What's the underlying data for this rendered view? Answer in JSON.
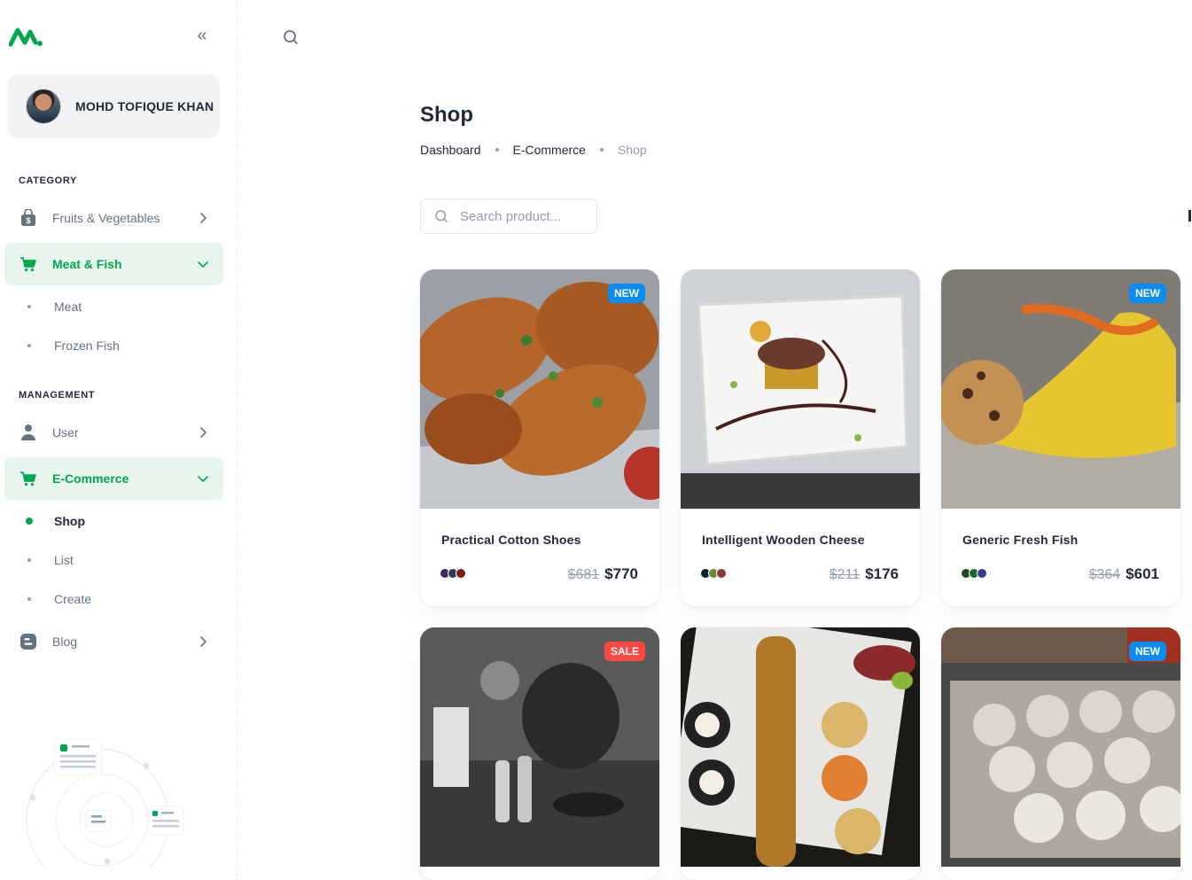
{
  "sidebar": {
    "account_name": "MOHD TOFIQUE KHAN",
    "category_title": "CATEGORY",
    "management_title": "MANAGEMENT",
    "items": [
      {
        "label": "Fruits & Vegetables",
        "icon": "shopping-bag-icon"
      },
      {
        "label": "Meat & Fish",
        "icon": "cart-icon",
        "active": true
      },
      {
        "label": "User",
        "icon": "user-icon"
      },
      {
        "label": "E-Commerce",
        "icon": "cart-icon",
        "active": true
      },
      {
        "label": "Blog",
        "icon": "blog-icon"
      }
    ],
    "meat_sub": [
      "Meat",
      "Frozen Fish"
    ],
    "ecommerce_sub": [
      "Shop",
      "List",
      "Create"
    ],
    "active_sub": "Shop"
  },
  "page": {
    "title": "Shop",
    "breadcrumb": [
      "Dashboard",
      "E-Commerce",
      "Shop"
    ]
  },
  "search": {
    "placeholder": "Search product..."
  },
  "colors": {
    "primary": "#00a651",
    "new_badge": "#0c8cf0",
    "sale_badge": "#ff4842"
  },
  "products": [
    {
      "name": "Practical Cotton Shoes",
      "badge": "NEW",
      "old_price": "$681",
      "price": "$770",
      "colors": [
        "#3a2a5c",
        "#2e3d55",
        "#7a1a1a"
      ]
    },
    {
      "name": "Intelligent Wooden Cheese",
      "badge": "",
      "old_price": "$211",
      "price": "$176",
      "colors": [
        "#0b2433",
        "#6b8a3a",
        "#8a3a30"
      ]
    },
    {
      "name": "Generic Fresh Fish",
      "badge": "NEW",
      "old_price": "$364",
      "price": "$601",
      "colors": [
        "#1f4a1f",
        "#1a6b2a",
        "#3a3a8a"
      ]
    },
    {
      "name": "",
      "badge": "SALE",
      "old_price": "",
      "price": "",
      "colors": []
    },
    {
      "name": "",
      "badge": "",
      "old_price": "",
      "price": "",
      "colors": []
    },
    {
      "name": "",
      "badge": "NEW",
      "old_price": "",
      "price": "",
      "colors": []
    }
  ]
}
